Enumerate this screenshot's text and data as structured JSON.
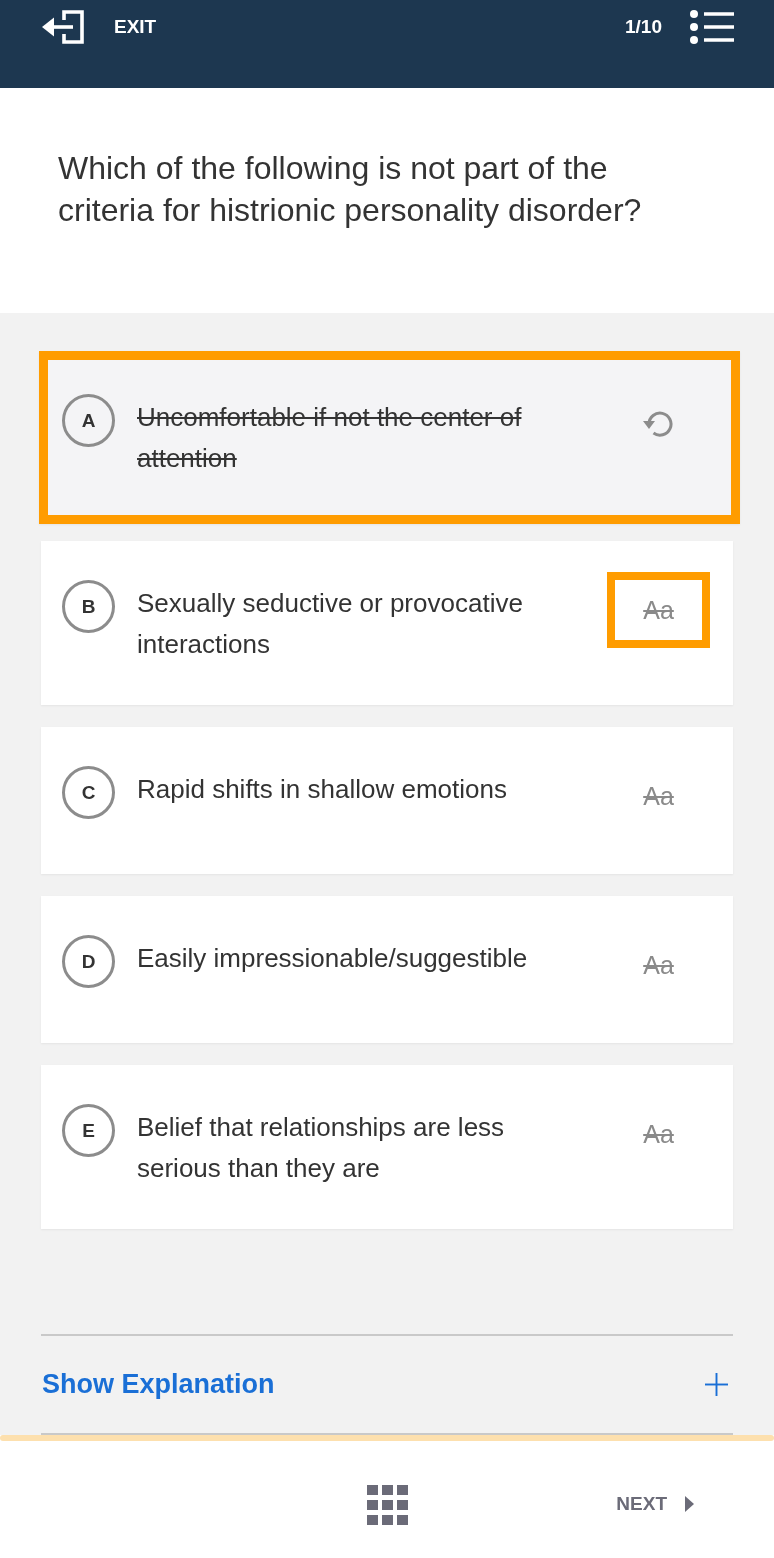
{
  "header": {
    "exit_label": "EXIT",
    "progress": "1/10"
  },
  "question": "Which of the following is not part of the criteria for histrionic personality disorder?",
  "options": [
    {
      "letter": "A",
      "text": "Uncomfortable if not the center of attention",
      "struck": true,
      "card_focused": true,
      "button_focused": false
    },
    {
      "letter": "B",
      "text": "Sexually seductive or provocative interactions",
      "struck": false,
      "card_focused": false,
      "button_focused": true,
      "strike_label": "Aa"
    },
    {
      "letter": "C",
      "text": "Rapid shifts in shallow emotions",
      "struck": false,
      "card_focused": false,
      "button_focused": false,
      "strike_label": "Aa"
    },
    {
      "letter": "D",
      "text": "Easily impressionable/suggestible",
      "struck": false,
      "card_focused": false,
      "button_focused": false,
      "strike_label": "Aa"
    },
    {
      "letter": "E",
      "text": "Belief that relationships are less serious than they are",
      "struck": false,
      "card_focused": false,
      "button_focused": false,
      "strike_label": "Aa"
    }
  ],
  "explanation": {
    "label": "Show Explanation",
    "expanded": false
  },
  "footer": {
    "next_label": "NEXT"
  }
}
